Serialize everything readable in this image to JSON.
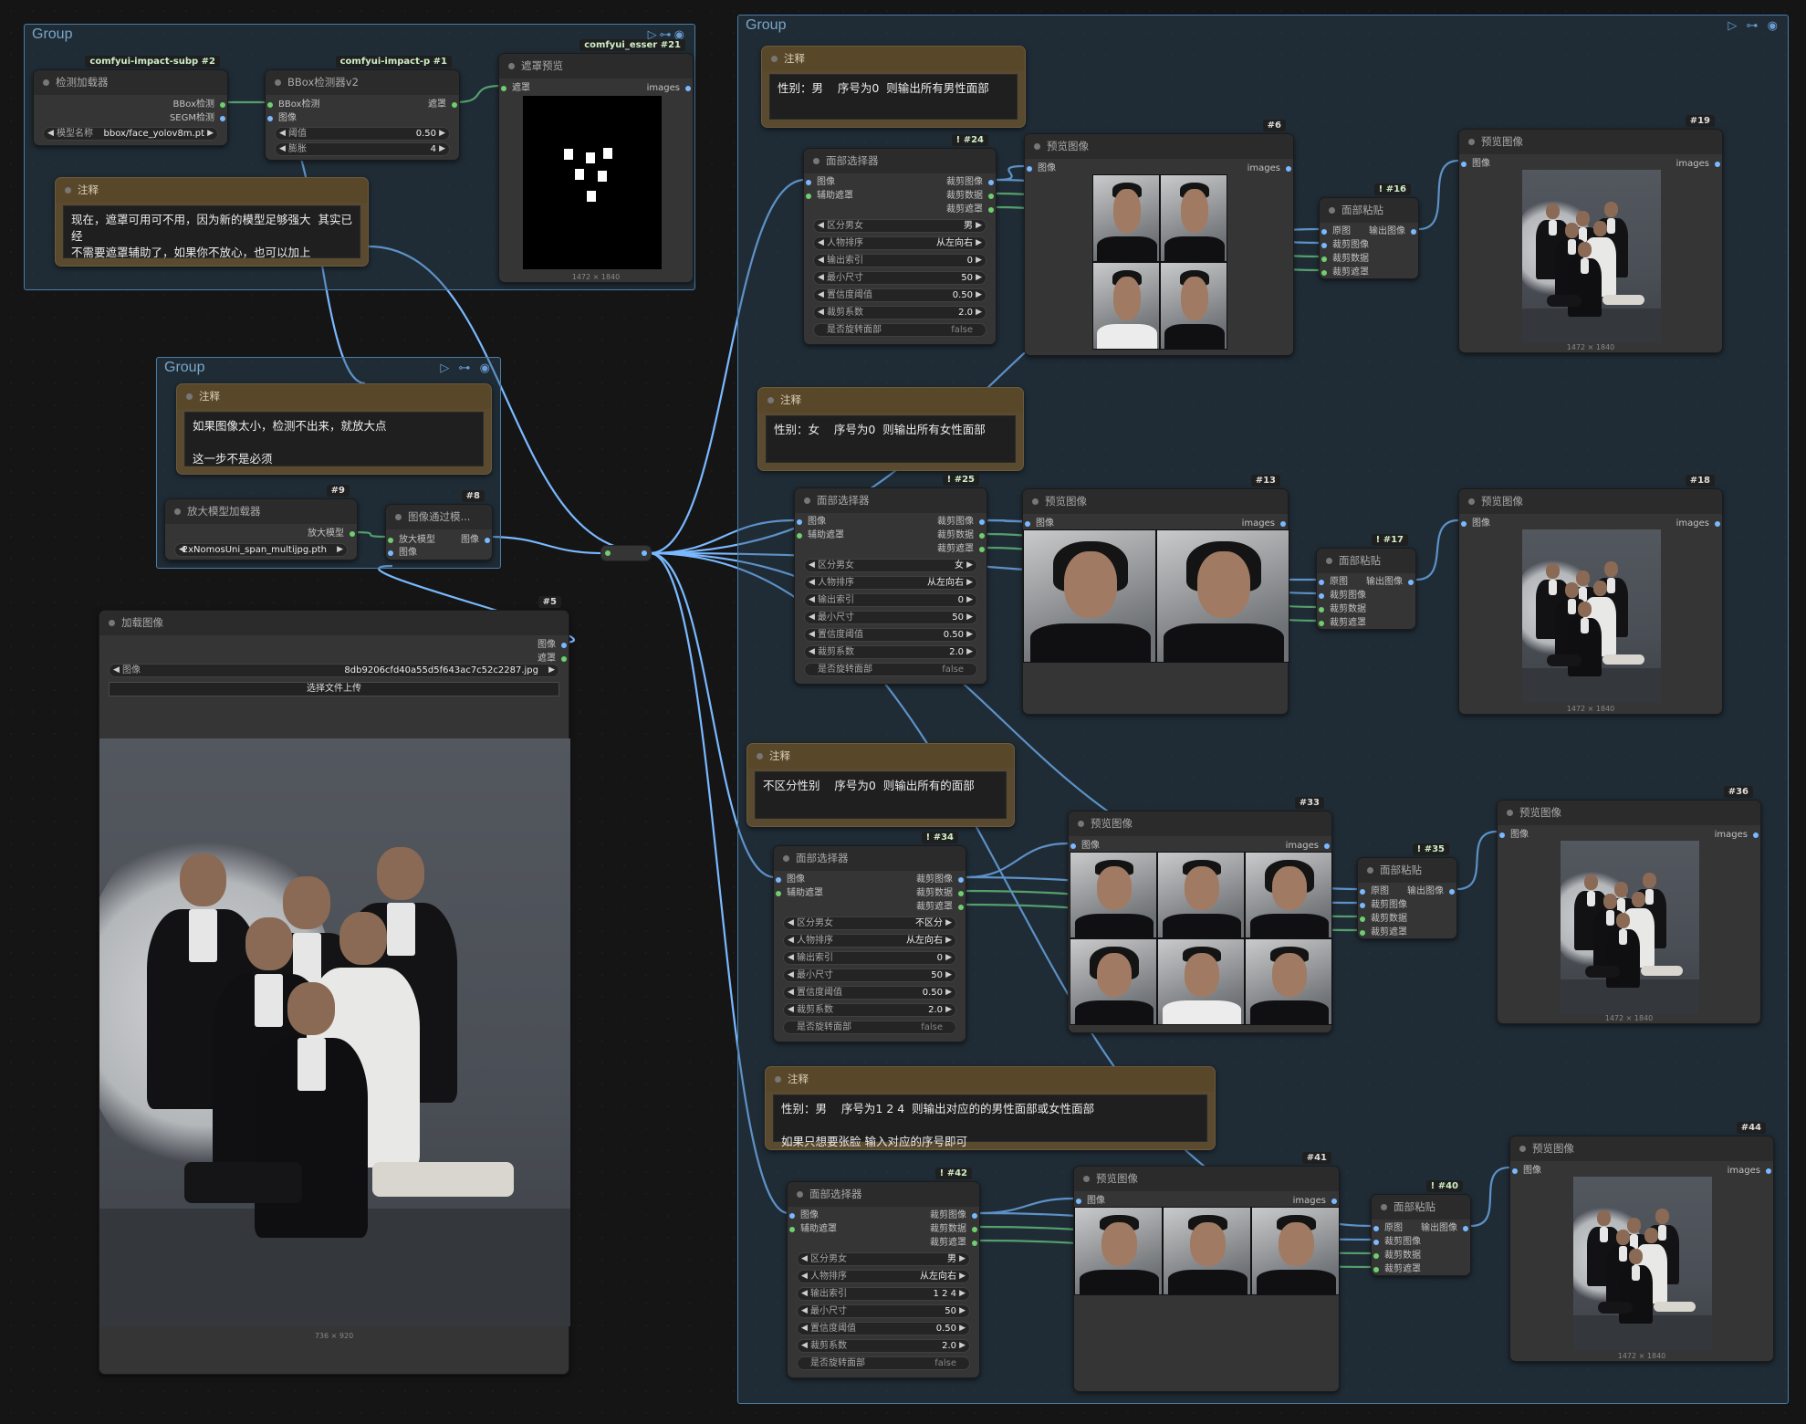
{
  "colors": {
    "canvas_bg": "#151515",
    "group_border": "#4a7ca8",
    "note_header": "#59472a",
    "link_image": "#7ab9ff",
    "link_mask": "#6fcf6f"
  },
  "group_top_left": {
    "title": "Group"
  },
  "group_right": {
    "title": "Group",
    "controls": "▷ ⊶ ◉"
  },
  "group_upscale": {
    "title": "Group",
    "controls": "▷ ⊶ ◉"
  },
  "detector_loader": {
    "badge": "comfyui-impact-subp  #2",
    "title": "检测加载器",
    "outputs": [
      "BBox检测",
      "SEGM检测"
    ],
    "widget_label": "模型名称",
    "widget_value": "bbox/face_yolov8m.pt"
  },
  "bbox_detector": {
    "badge": "comfyui-impact-p  #1",
    "title": "BBox检测器v2",
    "inputs": [
      "BBox检测",
      "图像"
    ],
    "output": "遮罩",
    "threshold_label": "阈值",
    "threshold_value": "0.50",
    "dilation_label": "膨胀",
    "dilation_value": "4"
  },
  "mask_preview": {
    "badge": "comfyui_esser  #21",
    "title": "遮罩预览",
    "input": "遮罩",
    "output": "images",
    "caption": "1472 × 1840"
  },
  "note_mask": {
    "title": "注释",
    "text": "现在，遮罩可用可不用，因为新的模型足够强大  其实已经\n不需要遮罩辅助了，如果你不放心，也可以加上"
  },
  "note_upscale": {
    "title": "注释",
    "text": "如果图像太小，检测不出来，就放大点\n\n这一步不是必须"
  },
  "upscale_loader": {
    "badge": "#9",
    "title": "放大模型加载器",
    "output": "放大模型",
    "widget_value": "2xNomosUni_span_multijpg.pth"
  },
  "upscale_image": {
    "badge": "#8",
    "title": "图像通过模...",
    "inputs": [
      "放大模型",
      "图像"
    ],
    "output": "图像"
  },
  "load_image": {
    "badge": "#5",
    "title": "加载图像",
    "outputs": [
      "图像",
      "遮罩"
    ],
    "widget_label": "图像",
    "widget_value": "8db9206cfd40a55d5f643ac7c52c2287.jpg",
    "upload_label": "选择文件上传",
    "caption": "736 × 920"
  },
  "notes": [
    {
      "title": "注释",
      "text": "性别：男    序号为0  则输出所有男性面部"
    },
    {
      "title": "注释",
      "text": "性别：女    序号为0  则输出所有女性面部"
    },
    {
      "title": "注释",
      "text": "不区分性别    序号为0  则输出所有的面部"
    },
    {
      "title": "注释",
      "text": "性别：男    序号为1 2 4  则输出对应的的男性面部或女性面部\n\n如果只想要张脸 输入对应的序号即可"
    }
  ],
  "face_selector_labels": {
    "title": "面部选择器",
    "inputs": [
      "图像",
      "辅助遮罩"
    ],
    "outputs": [
      "裁剪图像",
      "裁剪数据",
      "裁剪遮罩"
    ],
    "w_gender": "区分男女",
    "w_order": "人物排序",
    "w_index": "输出索引",
    "w_minsize": "最小尺寸",
    "w_conf": "置信度阈值",
    "w_crop": "裁剪系数",
    "w_rotate": "是否旋转面部"
  },
  "face_selectors": [
    {
      "badge": "! #24",
      "gender": "男",
      "order": "从左向右",
      "index": "0",
      "minsize": "50",
      "conf": "0.50",
      "crop": "2.0",
      "rotate": "false"
    },
    {
      "badge": "! #25",
      "gender": "女",
      "order": "从左向右",
      "index": "0",
      "minsize": "50",
      "conf": "0.50",
      "crop": "2.0",
      "rotate": "false"
    },
    {
      "badge": "! #34",
      "gender": "不区分",
      "order": "从左向右",
      "index": "0",
      "minsize": "50",
      "conf": "0.50",
      "crop": "2.0",
      "rotate": "false"
    },
    {
      "badge": "! #42",
      "gender": "男",
      "order": "从左向右",
      "index": "1 2 4",
      "minsize": "50",
      "conf": "0.50",
      "crop": "2.0",
      "rotate": "false"
    }
  ],
  "preview_labels": {
    "title": "预览图像",
    "input": "图像",
    "output": "images"
  },
  "previews_mid": [
    {
      "badge": "#6"
    },
    {
      "badge": "#13"
    },
    {
      "badge": "#33"
    },
    {
      "badge": "#41"
    }
  ],
  "paste_labels": {
    "title": "面部粘贴",
    "inputs": [
      "原图",
      "裁剪图像",
      "裁剪数据",
      "裁剪遮罩"
    ],
    "output": "输出图像"
  },
  "pastes": [
    {
      "badge": "! #16"
    },
    {
      "badge": "! #17"
    },
    {
      "badge": "! #35"
    },
    {
      "badge": "! #40"
    }
  ],
  "previews_right": [
    {
      "badge": "#19",
      "caption": "1472 × 1840"
    },
    {
      "badge": "#18",
      "caption": "1472 × 1840"
    },
    {
      "badge": "#36",
      "caption": "1472 × 1840"
    },
    {
      "badge": "#44",
      "caption": "1472 × 1840"
    }
  ]
}
